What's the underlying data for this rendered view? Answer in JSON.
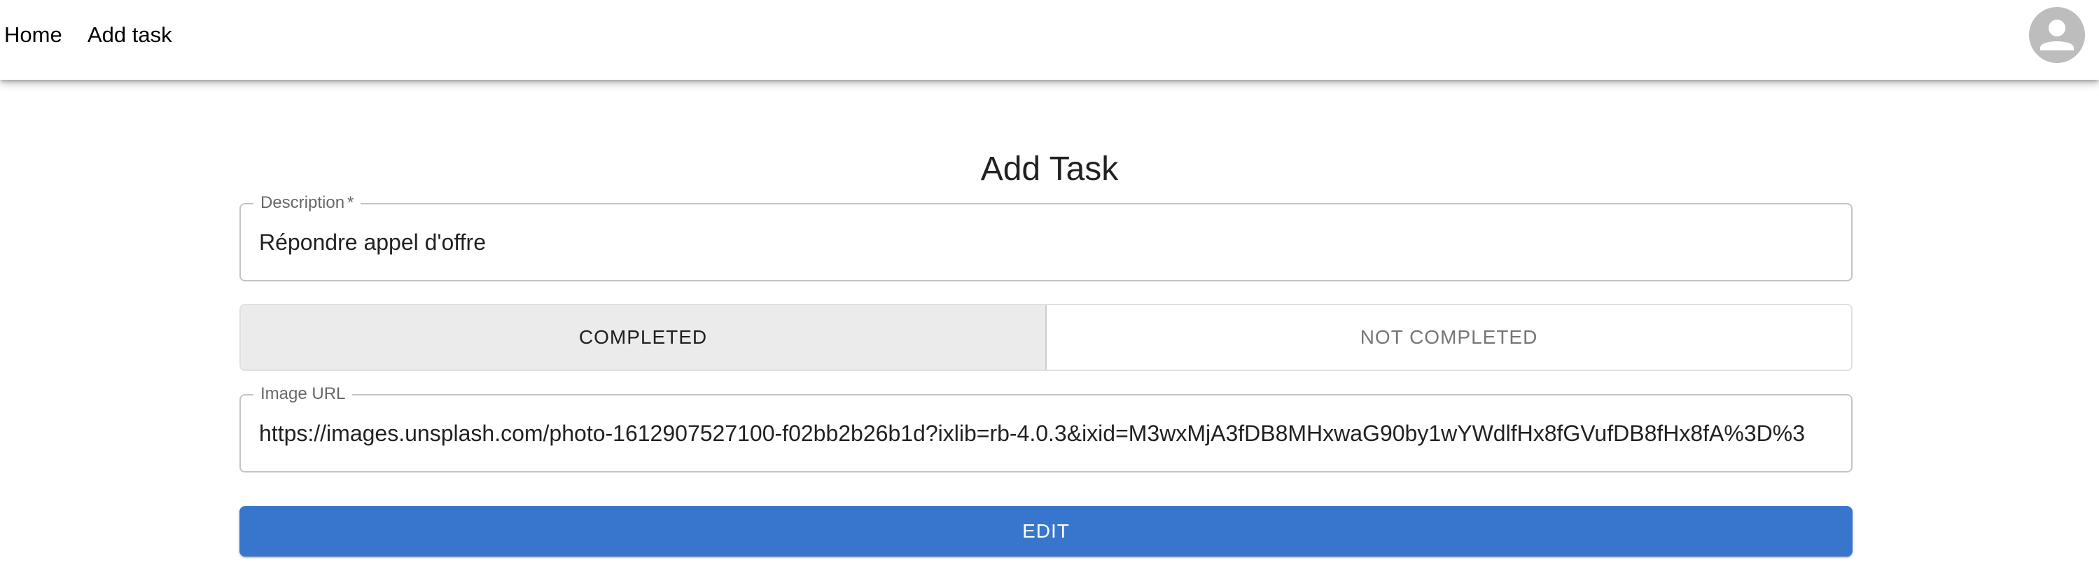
{
  "nav": {
    "home_label": "Home",
    "add_task_label": "Add task",
    "avatar_icon": "person-icon"
  },
  "page": {
    "title": "Add Task"
  },
  "form": {
    "description": {
      "label": "Description",
      "required_marker": "*",
      "value": "Répondre appel d'offre"
    },
    "status_toggle": {
      "options": [
        "COMPLETED",
        "NOT COMPLETED"
      ],
      "selected": "COMPLETED"
    },
    "image_url": {
      "label": "Image URL",
      "value": "https://images.unsplash.com/photo-1612907527100-f02bb2b26b1d?ixlib=rb-4.0.3&ixid=M3wxMjA3fDB8MHxwaG90by1wYWdlfHx8fGVufDB8fHx8fA%3D%3"
    },
    "submit_label": "EDIT"
  },
  "colors": {
    "primary": "#3776cc",
    "avatar_bg": "#bdbdbd",
    "toggle_selected_bg": "#ebebeb"
  }
}
